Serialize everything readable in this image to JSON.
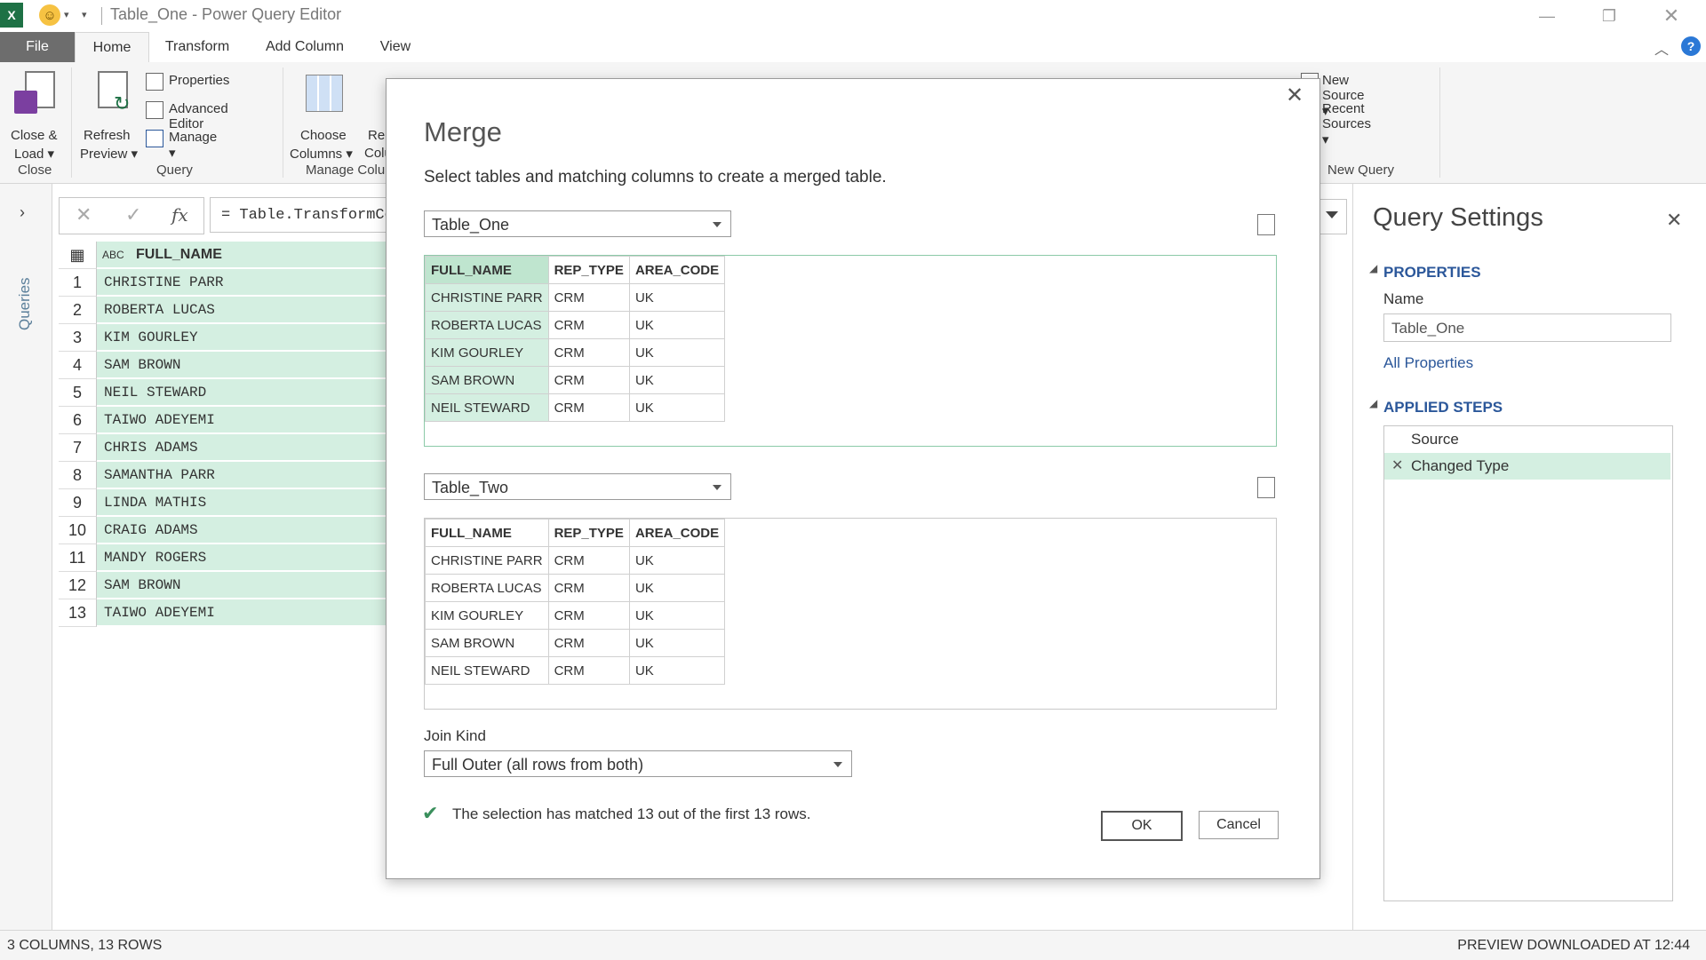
{
  "window": {
    "title": "Table_One - Power Query Editor",
    "excel_letter": "X"
  },
  "tabs": [
    "File",
    "Home",
    "Transform",
    "Add Column",
    "View"
  ],
  "ribbon": {
    "close_load": [
      "Close &",
      "Load ▾"
    ],
    "refresh_preview": [
      "Refresh",
      "Preview ▾"
    ],
    "properties": "Properties",
    "advanced_editor": "Advanced Editor",
    "manage": "Manage ▾",
    "choose_columns": [
      "Choose",
      "Columns ▾"
    ],
    "remove_columns_partial": [
      "Re",
      "Colu"
    ],
    "new_source": "New Source ▾",
    "recent_sources": "Recent Sources ▾",
    "groups": {
      "close": "Close",
      "query": "Query",
      "manage_columns": "Manage Colu",
      "new_query": "New Query"
    }
  },
  "left_pane": {
    "label": "Queries"
  },
  "formula_bar": {
    "fx": "fx",
    "text": "= Table.TransformCo"
  },
  "grid": {
    "column_header": "FULL_NAME",
    "type_icon": "ABC",
    "rows": [
      {
        "n": "1",
        "v": "CHRISTINE PARR"
      },
      {
        "n": "2",
        "v": "ROBERTA LUCAS"
      },
      {
        "n": "3",
        "v": "KIM GOURLEY"
      },
      {
        "n": "4",
        "v": "SAM BROWN"
      },
      {
        "n": "5",
        "v": "NEIL STEWARD"
      },
      {
        "n": "6",
        "v": "TAIWO ADEYEMI"
      },
      {
        "n": "7",
        "v": "CHRIS ADAMS"
      },
      {
        "n": "8",
        "v": "SAMANTHA PARR"
      },
      {
        "n": "9",
        "v": "LINDA MATHIS"
      },
      {
        "n": "10",
        "v": "CRAIG ADAMS"
      },
      {
        "n": "11",
        "v": "MANDY ROGERS"
      },
      {
        "n": "12",
        "v": "SAM BROWN"
      },
      {
        "n": "13",
        "v": "TAIWO ADEYEMI"
      }
    ]
  },
  "query_settings": {
    "title": "Query Settings",
    "properties_header": "PROPERTIES",
    "name_label": "Name",
    "name_value": "Table_One",
    "all_properties": "All Properties",
    "applied_steps_header": "APPLIED STEPS",
    "steps": [
      "Source",
      "Changed Type"
    ]
  },
  "status_bar": {
    "left": "3 COLUMNS, 13 ROWS",
    "right": "PREVIEW DOWNLOADED AT 12:44"
  },
  "merge_dialog": {
    "title": "Merge",
    "subtitle": "Select tables and matching columns to create a merged table.",
    "table1_select": "Table_One",
    "table2_select": "Table_Two",
    "columns": [
      "FULL_NAME",
      "REP_TYPE",
      "AREA_CODE"
    ],
    "table1_rows": [
      [
        "CHRISTINE PARR",
        "CRM",
        "UK"
      ],
      [
        "ROBERTA LUCAS",
        "CRM",
        "UK"
      ],
      [
        "KIM GOURLEY",
        "CRM",
        "UK"
      ],
      [
        "SAM BROWN",
        "CRM",
        "UK"
      ],
      [
        "NEIL STEWARD",
        "CRM",
        "UK"
      ]
    ],
    "table2_rows": [
      [
        "CHRISTINE PARR",
        "CRM",
        "UK"
      ],
      [
        "ROBERTA LUCAS",
        "CRM",
        "UK"
      ],
      [
        "KIM GOURLEY",
        "CRM",
        "UK"
      ],
      [
        "SAM BROWN",
        "CRM",
        "UK"
      ],
      [
        "NEIL STEWARD",
        "CRM",
        "UK"
      ]
    ],
    "join_kind_label": "Join Kind",
    "join_kind_value": "Full Outer (all rows from both)",
    "match_message": "The selection has matched 13 out of the first 13 rows.",
    "ok": "OK",
    "cancel": "Cancel"
  },
  "colors": {
    "selected_column": "#d4efe1",
    "accent_blue": "#2b579a",
    "excel_green": "#1e7145"
  }
}
